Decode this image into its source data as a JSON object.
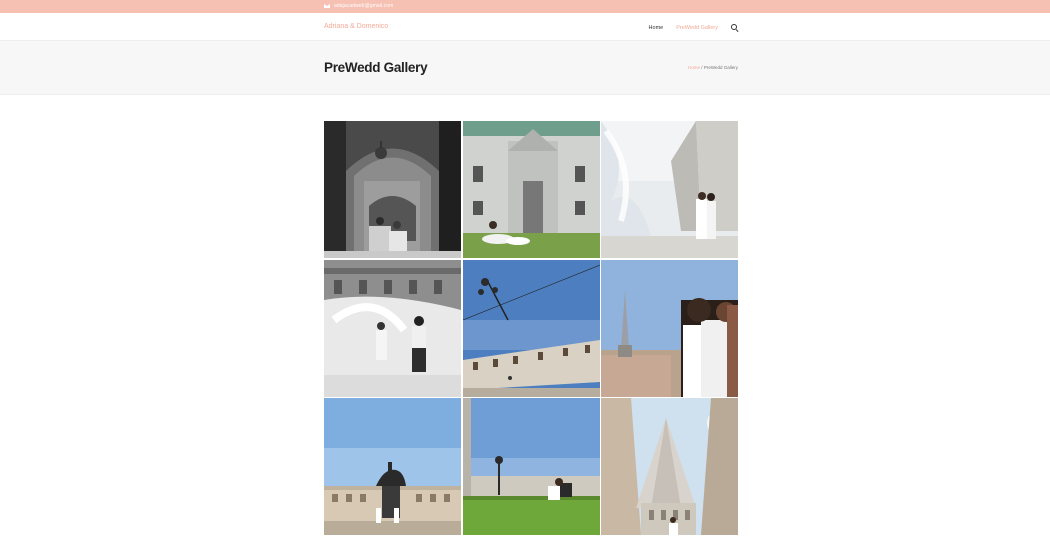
{
  "topbar": {
    "email": "adajacadweb@gmail.com"
  },
  "header": {
    "brand": "Adriana & Domenico",
    "nav": [
      {
        "label": "Home"
      },
      {
        "label": "PreWedd Gallery"
      }
    ]
  },
  "titlebar": {
    "title": "PreWedd Gallery",
    "breadcrumb": {
      "home": "Home",
      "separator": " / ",
      "current": "PreWedd Gallery"
    }
  },
  "gallery": {
    "photos": [
      {
        "icon": "photo-archway-bw"
      },
      {
        "icon": "photo-lawn-building"
      },
      {
        "icon": "photo-fountain-couple"
      },
      {
        "icon": "photo-fountain-bw"
      },
      {
        "icon": "photo-piazza-lamp"
      },
      {
        "icon": "photo-kiss-city"
      },
      {
        "icon": "photo-statue-square"
      },
      {
        "icon": "photo-garden-lift"
      },
      {
        "icon": "photo-mole-tower"
      }
    ]
  },
  "colors": {
    "accent": "#f4a998",
    "topbar": "#f6c0b3"
  }
}
